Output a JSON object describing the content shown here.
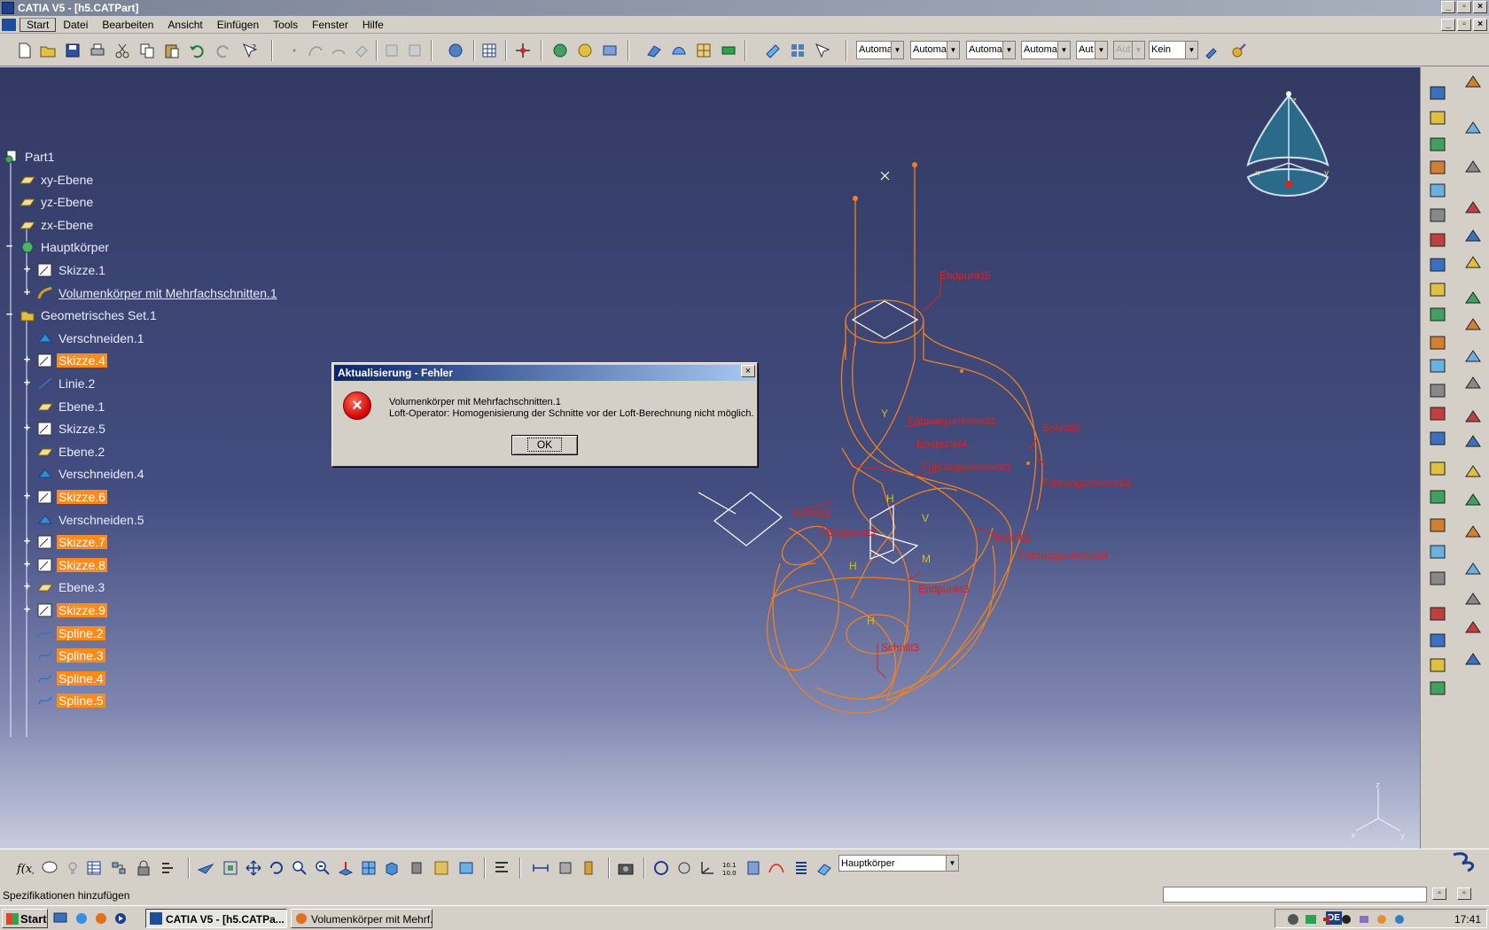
{
  "window": {
    "title": "CATIA V5 - [h5.CATPart]"
  },
  "menu": {
    "items": [
      "Start",
      "Datei",
      "Bearbeiten",
      "Ansicht",
      "Einfügen",
      "Tools",
      "Fenster",
      "Hilfe"
    ]
  },
  "toolbar": {
    "combos": [
      "Automa",
      "Automa",
      "Automa",
      "Automa",
      "Aut",
      "Aut",
      "Kein"
    ]
  },
  "tree": {
    "items": [
      {
        "label": "Part1"
      },
      {
        "label": "xy-Ebene"
      },
      {
        "label": "yz-Ebene"
      },
      {
        "label": "zx-Ebene"
      },
      {
        "label": "Hauptkörper"
      },
      {
        "label": "Skizze.1"
      },
      {
        "label": "Volumenkörper mit Mehrfachschnitten.1"
      },
      {
        "label": "Geometrisches Set.1"
      },
      {
        "label": "Verschneiden.1"
      },
      {
        "label": "Skizze.4"
      },
      {
        "label": "Linie.2"
      },
      {
        "label": "Ebene.1"
      },
      {
        "label": "Skizze.5"
      },
      {
        "label": "Ebene.2"
      },
      {
        "label": "Verschneiden.4"
      },
      {
        "label": "Skizze.6"
      },
      {
        "label": "Verschneiden.5"
      },
      {
        "label": "Skizze.7"
      },
      {
        "label": "Skizze.8"
      },
      {
        "label": "Ebene.3"
      },
      {
        "label": "Skizze.9"
      },
      {
        "label": "Spline.2"
      },
      {
        "label": "Spline.3"
      },
      {
        "label": "Spline.4"
      },
      {
        "label": "Spline.5"
      }
    ]
  },
  "annotations": [
    "Endpunkt5",
    "Führungselement1",
    "Endpunkt4",
    "Führungselement3",
    "Schnitt5",
    "Führungselement2",
    "Schnitt1",
    "Endpunkt1",
    "Schnitt2",
    "Führungselement4",
    "Endpunkt3",
    "Schnitt3",
    "H",
    "H",
    "H",
    "M",
    "V",
    "Y"
  ],
  "compass": {
    "z": "z",
    "x": "x",
    "y": "y"
  },
  "axis_triad": {
    "z": "z",
    "x": "x",
    "y": "y"
  },
  "dialog": {
    "title": "Aktualisierung - Fehler",
    "close": "×",
    "error_glyph": "×",
    "line1": "Volumenkörper mit Mehrfachschnitten.1",
    "line2": "Loft-Operator: Homogenisierung der Schnitte vor der Loft-Berechnung nicht möglich.",
    "ok": "OK"
  },
  "bottom_toolbar": {
    "body_combo": "Hauptkörper"
  },
  "status": {
    "text": "Spezifikationen hinzufügen"
  },
  "taskbar": {
    "start": "Start",
    "tasks": [
      "CATIA V5 - [h5.CATPa...",
      "Volumenkörper mit Mehrf..."
    ],
    "lang": "DE",
    "clock": "17:41"
  },
  "colors": {
    "highlight": "#ff8a1c",
    "geometry": "#f08020",
    "annotation": "#e0201a"
  }
}
